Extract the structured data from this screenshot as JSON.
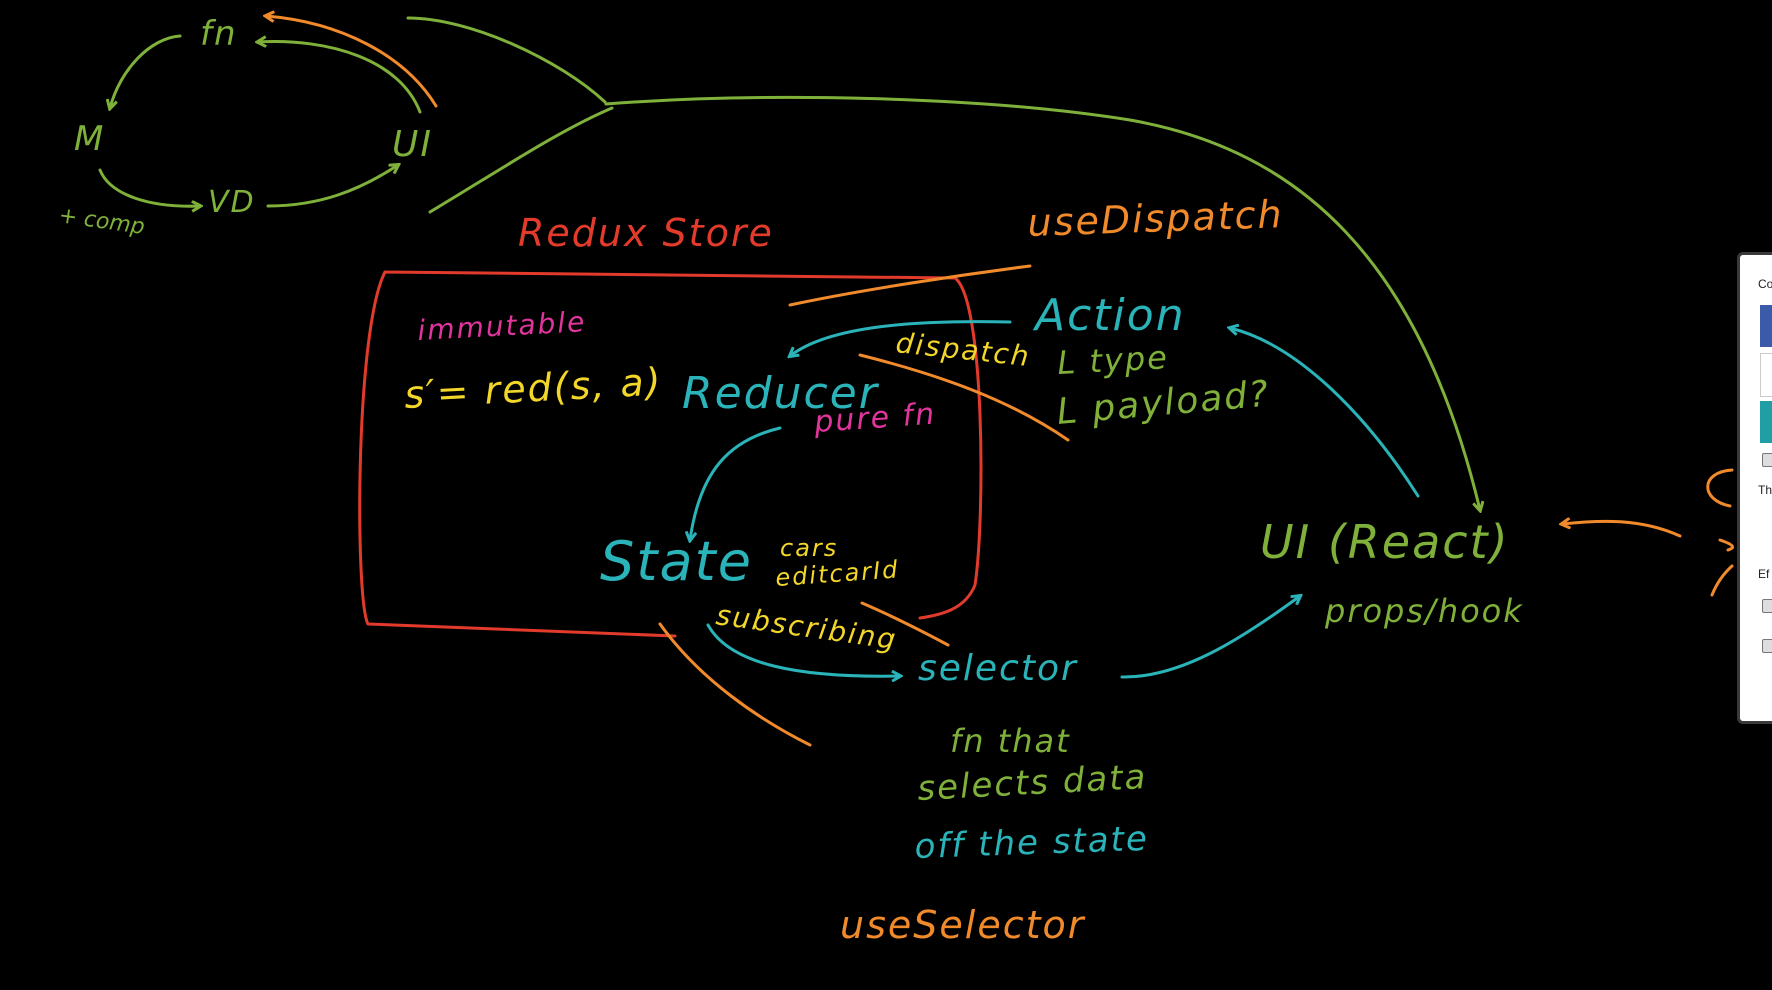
{
  "colors": {
    "background": "#000000",
    "green": "#7fb13a",
    "orange": "#f08a2b",
    "red": "#e23b2c",
    "teal": "#2ab3b8",
    "yellow": "#f2d72a",
    "magenta": "#e0359c",
    "blue_swatch": "#3b5aa8",
    "teal_swatch": "#1f9fa3"
  },
  "mvc_loop": {
    "fn": "fn",
    "m": "M",
    "ui": "UI",
    "vd": "VD",
    "comp": "+ comp"
  },
  "store": {
    "title": "Redux Store",
    "immutable": "immutable",
    "formula": "s′= red(s, a)",
    "reducer": "Reducer",
    "pure_fn": "pure fn",
    "state": "State",
    "state_fields": [
      "cars",
      "editcarId"
    ]
  },
  "labels": {
    "use_dispatch": "useDispatch",
    "action": "Action",
    "action_type": "L type",
    "action_payload": "L payload?",
    "dispatch": "dispatch",
    "ui_react": "UI (React)",
    "props_hook": "props/hook",
    "subscribing": "subscribing",
    "selector": "selector",
    "selector_desc": [
      "fn that",
      "selects data",
      "off the state"
    ],
    "use_selector": "useSelector"
  },
  "side_panel": {
    "text_top": "Co",
    "text_mid": "Th",
    "text_bottom": "Ef"
  }
}
